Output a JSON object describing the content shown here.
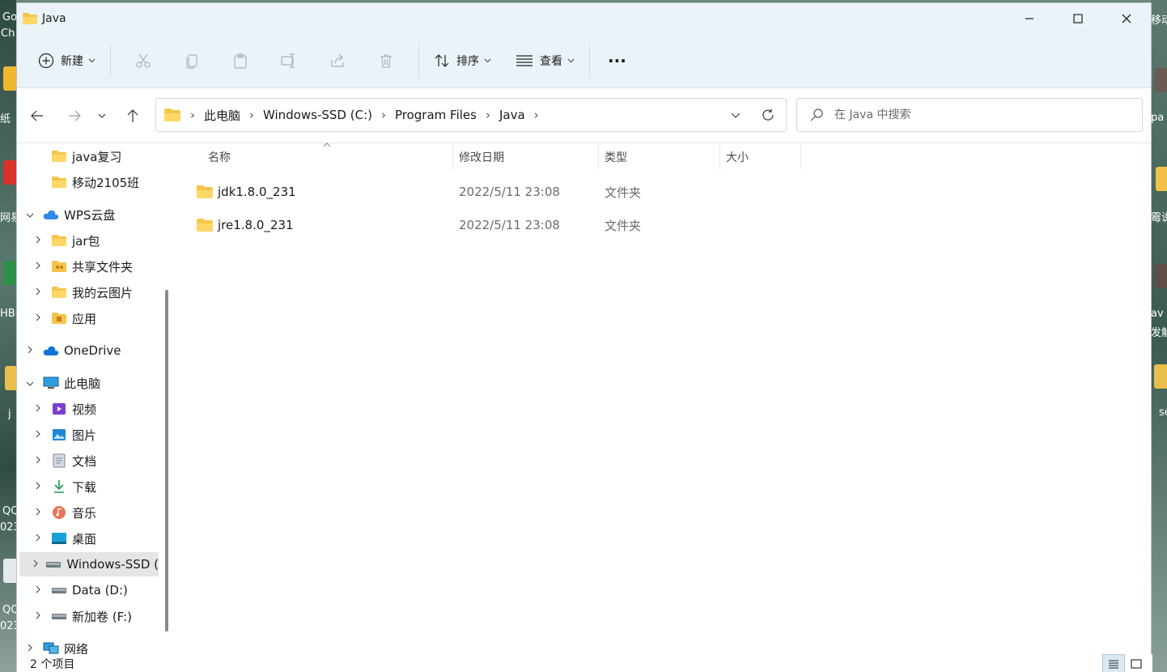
{
  "window": {
    "title": "Java"
  },
  "toolbar": {
    "new_label": "新建",
    "sort_label": "排序",
    "view_label": "查看",
    "more_label": "···"
  },
  "address": {
    "crumbs": [
      "此电脑",
      "Windows-SSD (C:)",
      "Program Files",
      "Java"
    ]
  },
  "search": {
    "placeholder": "在 Java 中搜索"
  },
  "navpane": {
    "items": [
      {
        "label": "java复习",
        "icon": "folder-icon",
        "level": 1
      },
      {
        "label": "移动2105班",
        "icon": "folder-icon",
        "level": 1
      },
      {
        "label": "WPS云盘",
        "icon": "cloud-icon",
        "level": 0
      },
      {
        "label": "jar包",
        "icon": "folder-icon",
        "level": 1
      },
      {
        "label": "共享文件夹",
        "icon": "shared-folder-icon",
        "level": 1
      },
      {
        "label": "我的云图片",
        "icon": "folder-icon",
        "level": 1
      },
      {
        "label": "应用",
        "icon": "app-folder-icon",
        "level": 1
      },
      {
        "label": "OneDrive",
        "icon": "onedrive-icon",
        "level": 0
      },
      {
        "label": "此电脑",
        "icon": "computer-icon",
        "level": 0
      },
      {
        "label": "视频",
        "icon": "video-icon",
        "level": 1
      },
      {
        "label": "图片",
        "icon": "pictures-icon",
        "level": 1
      },
      {
        "label": "文档",
        "icon": "documents-icon",
        "level": 1
      },
      {
        "label": "下载",
        "icon": "download-icon",
        "level": 1
      },
      {
        "label": "音乐",
        "icon": "music-icon",
        "level": 1
      },
      {
        "label": "桌面",
        "icon": "desktop-icon",
        "level": 1
      },
      {
        "label": "Windows-SSD (",
        "icon": "drive-icon",
        "level": 1
      },
      {
        "label": "Data (D:)",
        "icon": "drive-icon",
        "level": 1
      },
      {
        "label": "新加卷 (F:)",
        "icon": "drive-icon",
        "level": 1
      },
      {
        "label": "网络",
        "icon": "network-icon",
        "level": 0
      }
    ]
  },
  "columns": {
    "name": "名称",
    "date": "修改日期",
    "type": "类型",
    "size": "大小"
  },
  "files": [
    {
      "name": "jdk1.8.0_231",
      "date": "2022/5/11 23:08",
      "type": "文件夹"
    },
    {
      "name": "jre1.8.0_231",
      "date": "2022/5/11 23:08",
      "type": "文件夹"
    }
  ],
  "status": {
    "count": "2 个项目"
  },
  "desktop": {
    "left_labels": [
      "Go",
      "Ch",
      "纸",
      "网易",
      "HBu",
      "j",
      "QQ",
      "023",
      "QQ",
      "023"
    ],
    "right_labels": [
      "移动",
      "pa",
      "霉说",
      "av",
      "发解",
      "se"
    ]
  },
  "colors": {
    "titlebar_bg": "#eaf3f7",
    "folder_yellow": "#f3c54a",
    "selection": "#e5e5e5"
  }
}
